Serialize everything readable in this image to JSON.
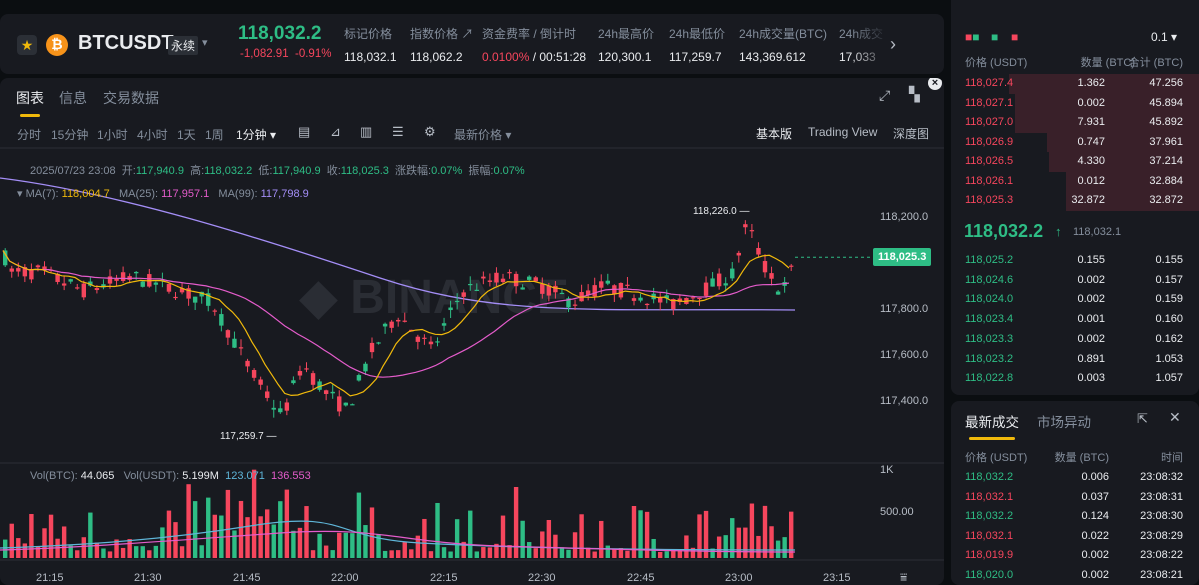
{
  "header": {
    "symbol": "BTCUSDT",
    "contract_type": "永续",
    "last_price": "118,032.2",
    "change_abs": "-1,082.91",
    "change_pct": "-0.91%",
    "stats": [
      {
        "label": "标记价格",
        "value": "118,032.1"
      },
      {
        "label": "指数价格 ↗",
        "value": "118,062.2"
      },
      {
        "label": "资金费率 / 倒计时",
        "value_rate": "0.0100%",
        "value_countdown": " / 00:51:28"
      },
      {
        "label": "24h最高价",
        "value": "120,300.1"
      },
      {
        "label": "24h最低价",
        "value": "117,259.7"
      },
      {
        "label": "24h成交量(BTC)",
        "value": "143,369.612"
      },
      {
        "label": "24h成交",
        "value": "17,033"
      }
    ]
  },
  "chart_panel": {
    "tabs": [
      "图表",
      "信息",
      "交易数据"
    ],
    "intervals": [
      "分时",
      "15分钟",
      "1小时",
      "4小时",
      "1天",
      "1周",
      "1分钟 ▾"
    ],
    "price_type": "最新价格 ▾",
    "views": [
      "基本版",
      "Trading View",
      "深度图"
    ],
    "info_bar": {
      "datetime": "2025/07/23 23:08",
      "open_label": "开:",
      "open": "117,940.9",
      "high_label": "高:",
      "high": "118,032.2",
      "low_label": "低:",
      "low": "117,940.9",
      "close_label": "收:",
      "close": "118,025.3",
      "chg_label": "涨跌幅:",
      "chg": "0.07%",
      "amp_label": "振幅:",
      "amp": "0.07%"
    },
    "ma_bar": {
      "ma7_label": "MA(7):",
      "ma7": "118,004.7",
      "ma25_label": "MA(25):",
      "ma25": "117,957.1",
      "ma99_label": "MA(99):",
      "ma99": "117,798.9"
    },
    "vol_bar": {
      "vol_btc_label": "Vol(BTC):",
      "vol_btc": "44.065",
      "vol_usdt_label": "Vol(USDT):",
      "vol_usdt": "5.199M",
      "v1": "123.071",
      "v2": "136.553"
    },
    "current_price_tag": "118,025.3",
    "high_marker": "118,226.0",
    "low_marker": "117,259.7",
    "price_axis": [
      "118,200.0",
      "118,025.3",
      "117,800.0",
      "117,600.0",
      "117,400.0"
    ],
    "volume_axis": [
      "1K",
      "500.00"
    ],
    "time_axis": [
      "21:15",
      "21:30",
      "21:45",
      "22:00",
      "22:15",
      "22:30",
      "22:45",
      "23:00",
      "23:15"
    ],
    "colors": {
      "up": "#2ebd85",
      "down": "#f6465d",
      "ma7": "#f0b90b",
      "ma25": "#e45ccb",
      "ma99": "#a48ef7"
    }
  },
  "chart_data": {
    "type": "candlestick",
    "interval": "1m",
    "y_range": [
      117200,
      118300
    ],
    "x_ticks": [
      "21:15",
      "21:30",
      "21:45",
      "22:00",
      "22:15",
      "22:30",
      "22:45",
      "23:00",
      "23:15"
    ],
    "last_close": 118025.3,
    "high": 118226.0,
    "low": 117259.7
  },
  "orderbook": {
    "precision": "0.1 ▾",
    "columns": [
      "价格 (USDT)",
      "数量 (BTC)",
      "合计 (BTC)"
    ],
    "asks": [
      {
        "price": "118,027.4",
        "qty": "1.362",
        "total": "47.256",
        "depth": 1.0
      },
      {
        "price": "118,027.1",
        "qty": "0.002",
        "total": "45.894",
        "depth": 0.97
      },
      {
        "price": "118,027.0",
        "qty": "7.931",
        "total": "45.892",
        "depth": 0.97
      },
      {
        "price": "118,026.9",
        "qty": "0.747",
        "total": "37.961",
        "depth": 0.8
      },
      {
        "price": "118,026.5",
        "qty": "4.330",
        "total": "37.214",
        "depth": 0.79
      },
      {
        "price": "118,026.1",
        "qty": "0.012",
        "total": "32.884",
        "depth": 0.7
      },
      {
        "price": "118,025.3",
        "qty": "32.872",
        "total": "32.872",
        "depth": 0.7
      }
    ],
    "mid_price": "118,032.2",
    "mid_mark": "118,032.1",
    "bids": [
      {
        "price": "118,025.2",
        "qty": "0.155",
        "total": "0.155"
      },
      {
        "price": "118,024.6",
        "qty": "0.002",
        "total": "0.157"
      },
      {
        "price": "118,024.0",
        "qty": "0.002",
        "total": "0.159"
      },
      {
        "price": "118,023.4",
        "qty": "0.001",
        "total": "0.160"
      },
      {
        "price": "118,023.3",
        "qty": "0.002",
        "total": "0.162"
      },
      {
        "price": "118,023.2",
        "qty": "0.891",
        "total": "1.053"
      },
      {
        "price": "118,022.8",
        "qty": "0.003",
        "total": "1.057"
      }
    ]
  },
  "trades": {
    "tabs": [
      "最新成交",
      "市场异动"
    ],
    "columns": [
      "价格 (USDT)",
      "数量 (BTC)",
      "时间"
    ],
    "rows": [
      {
        "price": "118,032.2",
        "side": "buy",
        "qty": "0.006",
        "time": "23:08:32"
      },
      {
        "price": "118,032.1",
        "side": "sell",
        "qty": "0.037",
        "time": "23:08:31"
      },
      {
        "price": "118,032.2",
        "side": "buy",
        "qty": "0.124",
        "time": "23:08:30"
      },
      {
        "price": "118,032.1",
        "side": "sell",
        "qty": "0.022",
        "time": "23:08:29"
      },
      {
        "price": "118,019.9",
        "side": "sell",
        "qty": "0.002",
        "time": "23:08:22"
      },
      {
        "price": "118,020.0",
        "side": "buy",
        "qty": "0.002",
        "time": "23:08:21"
      }
    ]
  }
}
